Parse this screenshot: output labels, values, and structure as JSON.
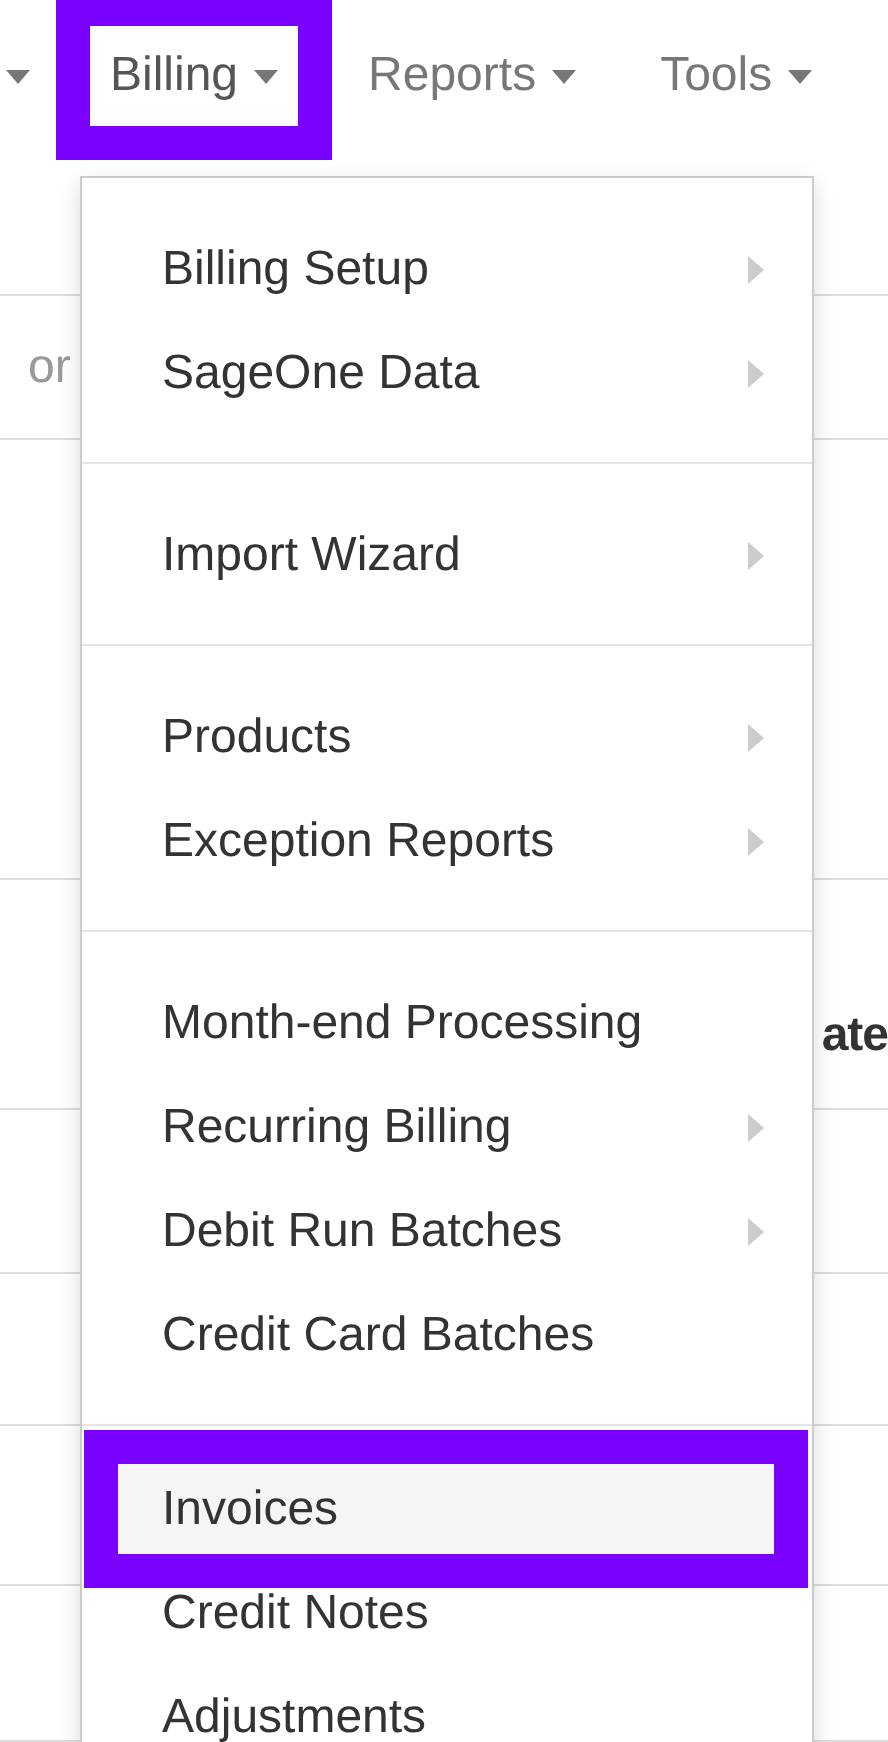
{
  "nav": {
    "items": [
      {
        "label": "Billing",
        "selected": true
      },
      {
        "label": "Reports",
        "selected": false
      },
      {
        "label": "Tools",
        "selected": false
      }
    ]
  },
  "background": {
    "rows": [
      {
        "left_text": "or"
      },
      {},
      {
        "right_text": "ate"
      },
      {},
      {},
      {},
      {}
    ]
  },
  "menu": {
    "groups": [
      {
        "items": [
          {
            "label": "Billing Setup",
            "has_submenu": true,
            "selected": false
          },
          {
            "label": "SageOne Data",
            "has_submenu": true,
            "selected": false
          }
        ]
      },
      {
        "items": [
          {
            "label": "Import Wizard",
            "has_submenu": true,
            "selected": false
          }
        ]
      },
      {
        "items": [
          {
            "label": "Products",
            "has_submenu": true,
            "selected": false
          },
          {
            "label": "Exception Reports",
            "has_submenu": true,
            "selected": false
          }
        ]
      },
      {
        "items": [
          {
            "label": "Month-end Processing",
            "has_submenu": false,
            "selected": false
          },
          {
            "label": "Recurring Billing",
            "has_submenu": true,
            "selected": false
          },
          {
            "label": "Debit Run Batches",
            "has_submenu": true,
            "selected": false
          },
          {
            "label": "Credit Card Batches",
            "has_submenu": false,
            "selected": false
          }
        ]
      },
      {
        "items": [
          {
            "label": "Invoices",
            "has_submenu": false,
            "selected": true
          },
          {
            "label": "Credit Notes",
            "has_submenu": false,
            "selected": false
          },
          {
            "label": "Adjustments",
            "has_submenu": false,
            "selected": false
          }
        ]
      }
    ]
  }
}
